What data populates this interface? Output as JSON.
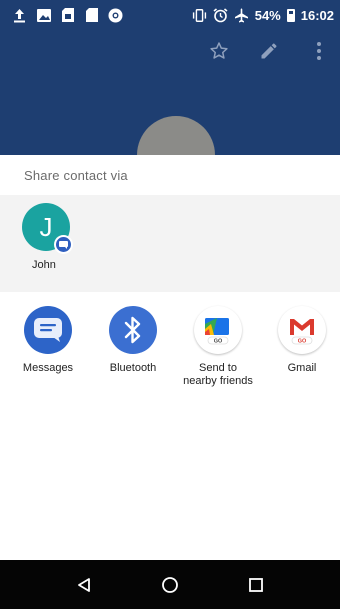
{
  "status_bar": {
    "battery": "54%",
    "time": "16:02",
    "left_icons": [
      "upload-icon",
      "image-icon",
      "sd-card-icon",
      "sim-icon",
      "chrome-icon"
    ],
    "right_icons": [
      "vibrate-icon",
      "alarm-icon",
      "airplane-icon",
      "battery-icon"
    ]
  },
  "header": {
    "actions": [
      "star-icon",
      "edit-pencil-icon",
      "more-vert-icon"
    ]
  },
  "share_sheet": {
    "title": "Share contact via",
    "direct_share": [
      {
        "name": "John",
        "initial": "J",
        "avatar_color": "#1aa3a0"
      }
    ],
    "apps": [
      {
        "label": "Messages",
        "icon": "messages-icon"
      },
      {
        "label": "Bluetooth",
        "icon": "bluetooth-icon"
      },
      {
        "label_line1": "Send to",
        "label_line2": "nearby friends",
        "icon": "files-go-icon"
      },
      {
        "label": "Gmail",
        "icon": "gmail-go-icon"
      }
    ]
  },
  "nav_bar": {
    "buttons": [
      "back-icon",
      "home-icon",
      "recents-icon"
    ]
  },
  "colors": {
    "header": "#1e3e71",
    "nav_bar": "#050505",
    "messages": "#2d64c8",
    "bluetooth": "#3b6fd1",
    "gmail_red": "#db3a2e"
  }
}
